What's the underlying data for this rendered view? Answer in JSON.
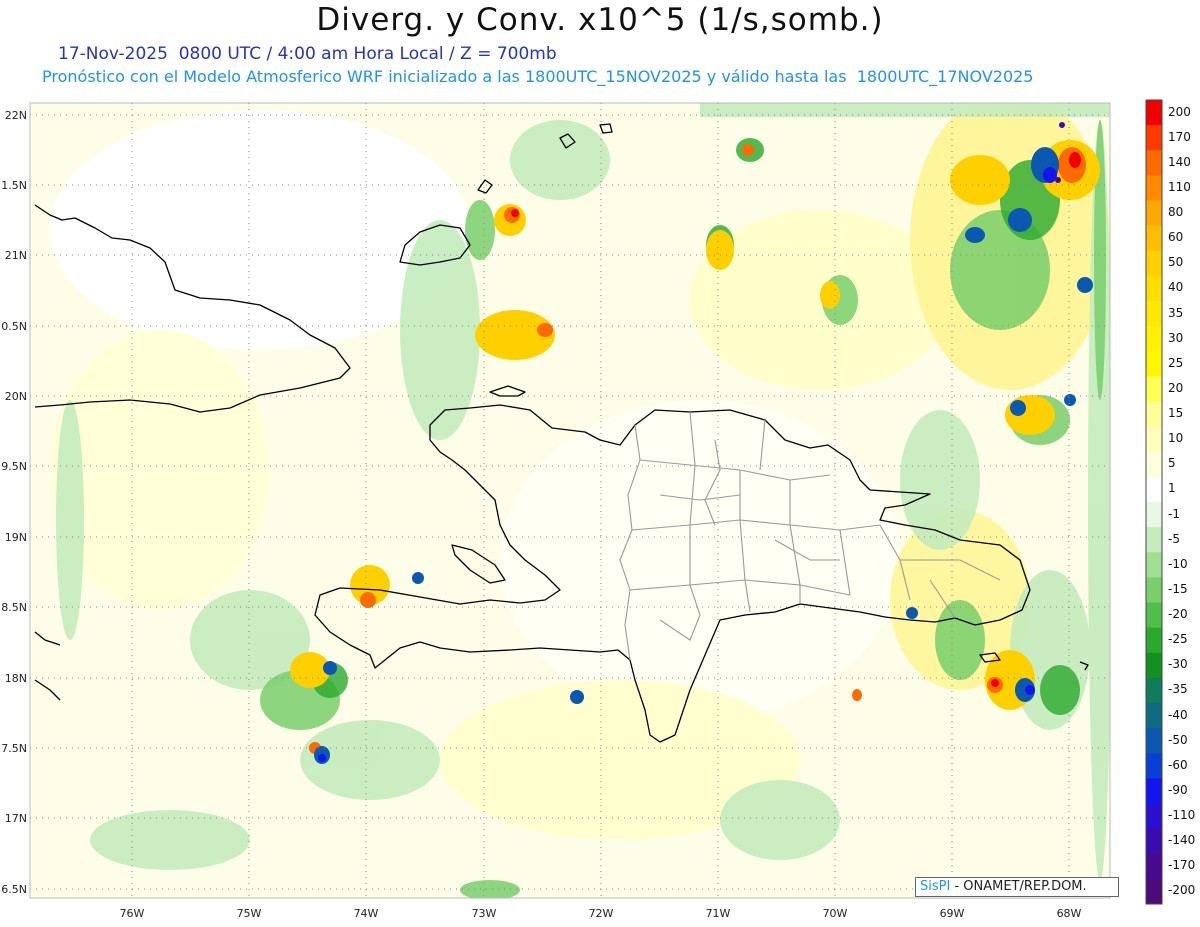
{
  "header": {
    "title": "Diverg. y Conv. x10^5 (1/s,somb.)",
    "line1": "17-Nov-2025  0800 UTC / 4:00 am Hora Local / Z = 700mb",
    "line2": "Pronóstico con el Modelo Atmosferico WRF inicializado a las 1800UTC_15NOV2025 y válido hasta las  1800UTC_17NOV2025"
  },
  "map": {
    "lat_labels": [
      "22N",
      "1.5N",
      "21N",
      "0.5N",
      "20N",
      "9.5N",
      "19N",
      "8.5N",
      "18N",
      "7.5N",
      "17N",
      "6.5N"
    ],
    "lon_labels": [
      "76W",
      "75W",
      "74W",
      "73W",
      "72W",
      "71W",
      "70W",
      "69W",
      "68W"
    ],
    "colors": {
      "land_border": "#000000",
      "province_border": "#999999",
      "grid": "#888888"
    }
  },
  "credit": {
    "brand": "SisPI",
    "text": " - ONAMET/REP.DOM."
  },
  "colorbar": {
    "labels": [
      "200",
      "170",
      "140",
      "110",
      "80",
      "60",
      "50",
      "40",
      "35",
      "30",
      "25",
      "20",
      "15",
      "10",
      "5",
      "1",
      "-1",
      "-5",
      "-10",
      "-15",
      "-20",
      "-25",
      "-30",
      "-35",
      "-40",
      "-50",
      "-60",
      "-90",
      "-110",
      "-140",
      "-170",
      "-200"
    ],
    "colors": [
      "#f00000",
      "#ff3a00",
      "#ff6a00",
      "#ff8a00",
      "#ffa800",
      "#ffbe00",
      "#ffd000",
      "#ffde00",
      "#ffe900",
      "#fff100",
      "#fff800",
      "#ffff55",
      "#ffff99",
      "#ffffbb",
      "#ffffdd",
      "#ffffff",
      "#eaf6e6",
      "#c4ecbc",
      "#9fdf92",
      "#79cf6c",
      "#4fbe4b",
      "#2aa92d",
      "#119220",
      "#0e7d5a",
      "#0c6c83",
      "#0b58b0",
      "#0a3fd6",
      "#1414f0",
      "#2a0fd0",
      "#3a0cb0",
      "#46098f",
      "#4c0a7a"
    ]
  }
}
